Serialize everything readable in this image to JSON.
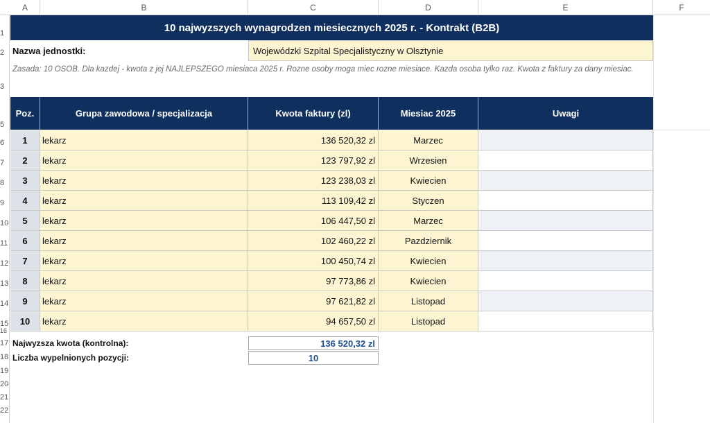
{
  "columns": [
    "A",
    "B",
    "C",
    "D",
    "E",
    "F"
  ],
  "rows": [
    "1",
    "2",
    "3",
    "5",
    "6",
    "7",
    "8",
    "9",
    "10",
    "11",
    "12",
    "13",
    "14",
    "15",
    "16",
    "17",
    "18",
    "19",
    "20",
    "21",
    "22"
  ],
  "title": "10 najwyzszych wynagrodzen miesiecznych 2025 r. - Kontrakt (B2B)",
  "unit": {
    "label": "Nazwa jednostki:",
    "value": "Wojewódzki Szpital Specjalistyczny w Olsztynie"
  },
  "rule": "Zasada: 10 OSOB. Dla kazdej - kwota z jej NAJLEPSZEGO miesiaca 2025 r. Rozne osoby moga miec rozne miesiace. Kazda osoba tylko raz. Kwota z faktury za dany miesiac.",
  "table": {
    "headers": {
      "poz": "Poz.",
      "group": "Grupa zawodowa / specjalizacja",
      "amount": "Kwota faktury (zl)",
      "month": "Miesiac 2025",
      "notes": "Uwagi"
    },
    "rows": [
      {
        "poz": "1",
        "group": "lekarz",
        "amount": "136 520,32 zl",
        "month": "Marzec",
        "notes": ""
      },
      {
        "poz": "2",
        "group": "lekarz",
        "amount": "123 797,92 zl",
        "month": "Wrzesien",
        "notes": ""
      },
      {
        "poz": "3",
        "group": "lekarz",
        "amount": "123 238,03 zl",
        "month": "Kwiecien",
        "notes": ""
      },
      {
        "poz": "4",
        "group": "lekarz",
        "amount": "113 109,42 zl",
        "month": "Styczen",
        "notes": ""
      },
      {
        "poz": "5",
        "group": "lekarz",
        "amount": "106 447,50 zl",
        "month": "Marzec",
        "notes": ""
      },
      {
        "poz": "6",
        "group": "lekarz",
        "amount": "102 460,22 zl",
        "month": "Pazdziernik",
        "notes": ""
      },
      {
        "poz": "7",
        "group": "lekarz",
        "amount": "100 450,74 zl",
        "month": "Kwiecien",
        "notes": ""
      },
      {
        "poz": "8",
        "group": "lekarz",
        "amount": "97 773,86 zl",
        "month": "Kwiecien",
        "notes": ""
      },
      {
        "poz": "9",
        "group": "lekarz",
        "amount": "97 621,82 zl",
        "month": "Listopad",
        "notes": ""
      },
      {
        "poz": "10",
        "group": "lekarz",
        "amount": "94 657,50 zl",
        "month": "Listopad",
        "notes": ""
      }
    ]
  },
  "summary": {
    "max_label": "Najwyzsza kwota (kontrolna):",
    "max_value": "136 520,32 zl",
    "count_label": "Liczba wypelnionych pozycji:",
    "count_value": "10"
  },
  "colors": {
    "header_navy": "#0f2f5e",
    "input_yellow": "#fdf5d2",
    "notes_band": "#eef1f5",
    "summary_blue": "#1f4e8c"
  }
}
